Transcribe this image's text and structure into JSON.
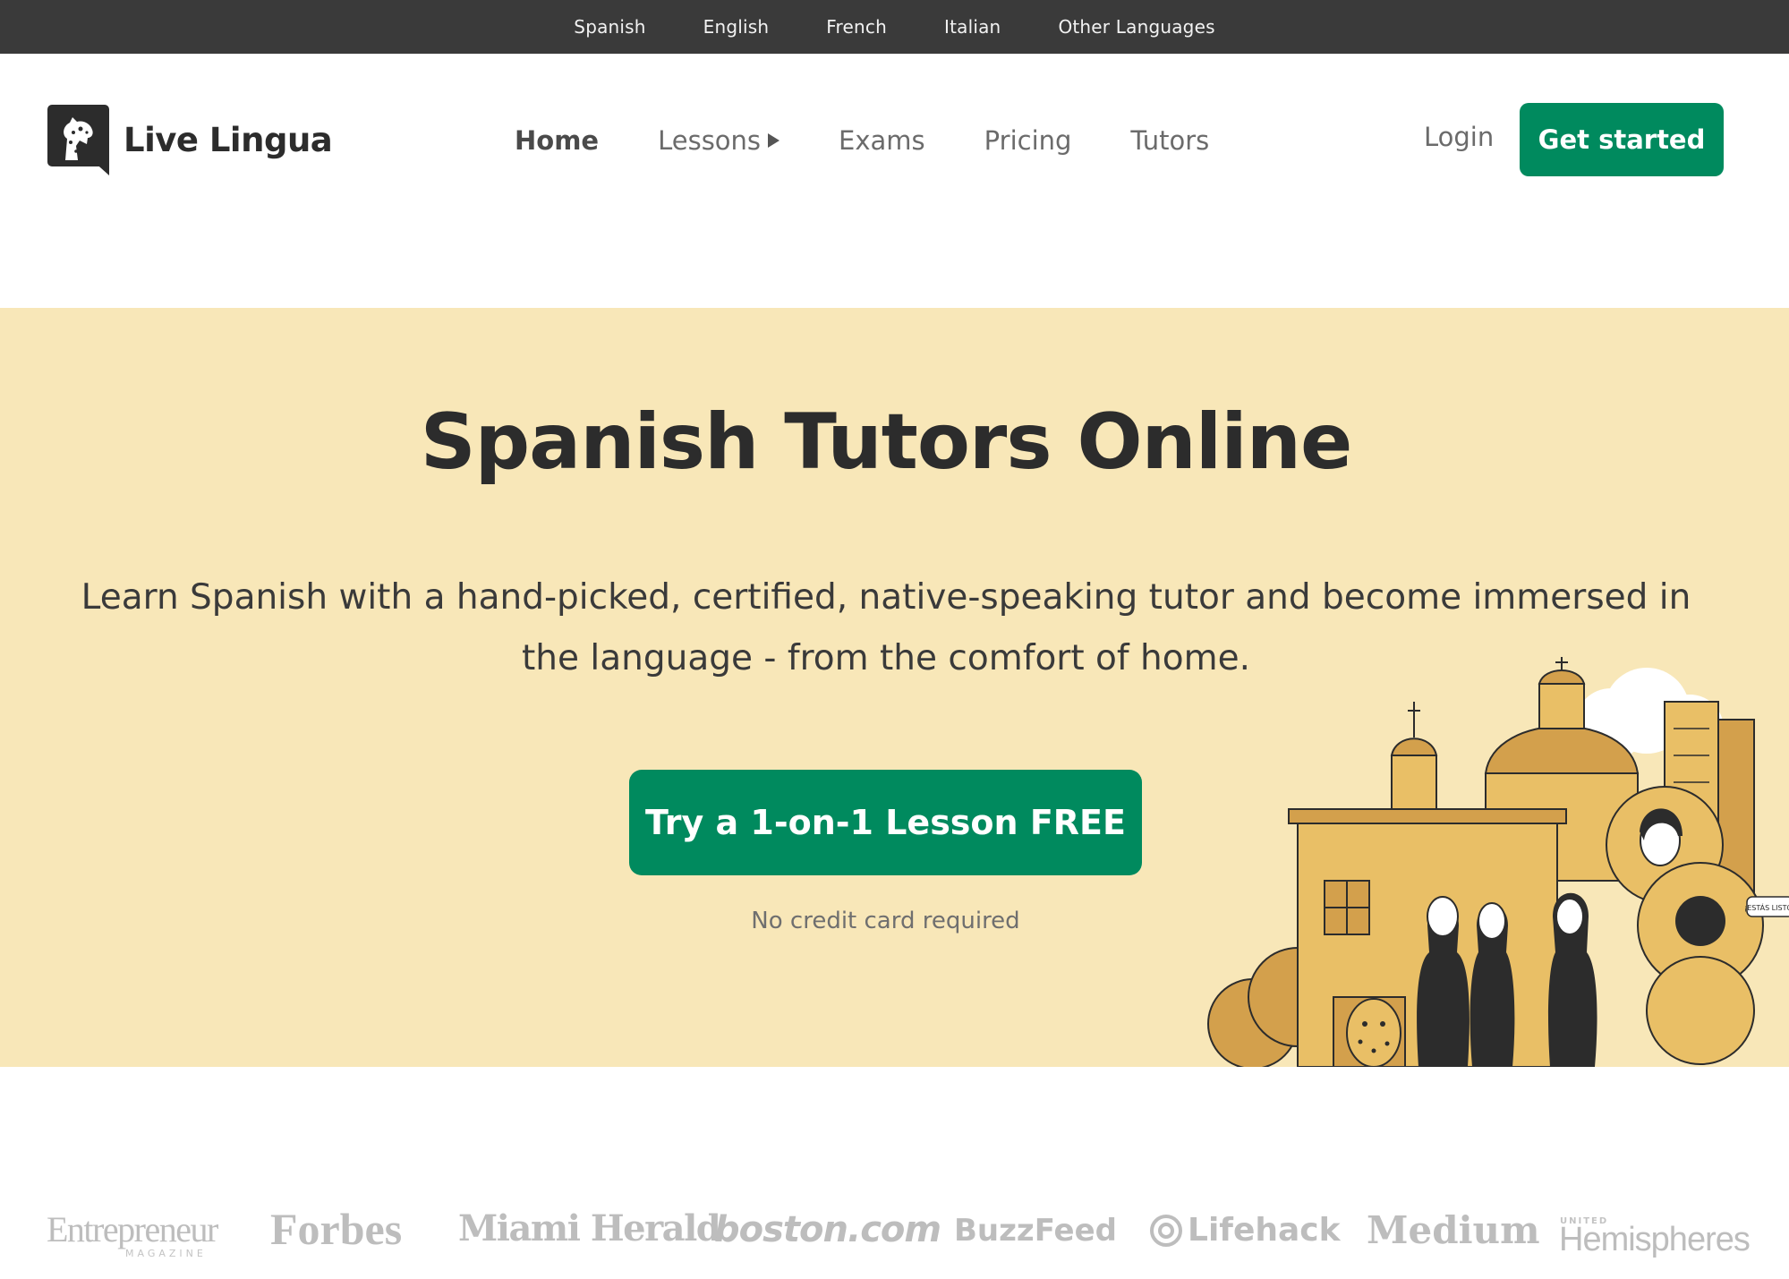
{
  "language_bar": {
    "items": [
      "Spanish",
      "English",
      "French",
      "Italian",
      "Other Languages"
    ]
  },
  "header": {
    "logo_text": "Live Lingua",
    "nav": [
      {
        "label": "Home",
        "active": true
      },
      {
        "label": "Lessons",
        "has_submenu": true
      },
      {
        "label": "Exams"
      },
      {
        "label": "Pricing"
      },
      {
        "label": "Tutors"
      }
    ],
    "login_label": "Login",
    "get_started_label": "Get started"
  },
  "hero": {
    "title": "Spanish Tutors Online",
    "subtitle": "Learn Spanish with a hand-picked, certified, native-speaking tutor and become immersed in the language - from the comfort of home.",
    "cta_label": "Try a 1-on-1 Lesson FREE",
    "note": "No credit card required",
    "illustration_speech_bubble": "¡ESTÁS LISTO?",
    "background_color": "#f8e7b8"
  },
  "press_logos": {
    "items": [
      "Entrepreneur",
      "Forbes",
      "Miami Herald",
      "boston.com",
      "BuzzFeed",
      "Lifehack",
      "Medium",
      "Hemispheres"
    ],
    "entrepreneur_sub": "MAGAZINE",
    "hemispheres_sub": "UNITED"
  },
  "colors": {
    "accent": "#008a5e",
    "topbar": "#3a3a3a",
    "hero_bg": "#f8e7b8",
    "press_gray": "#bdbdbd"
  }
}
